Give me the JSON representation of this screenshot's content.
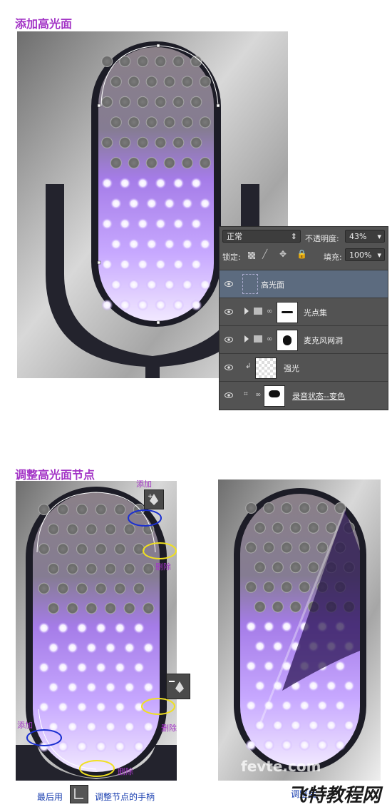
{
  "section1": {
    "title": "添加高光面",
    "panel": {
      "blend_mode": "正常",
      "opacity_label": "不透明度:",
      "opacity_value": "43%",
      "lock_label": "锁定:",
      "fill_label": "填充:",
      "fill_value": "100%",
      "layers": [
        {
          "name": "高光面",
          "active": true
        },
        {
          "name": "光点集",
          "active": false
        },
        {
          "name": "麦克风网洞",
          "active": false
        },
        {
          "name": "强光",
          "active": false
        },
        {
          "name": "录音状态--变色",
          "active": false
        }
      ]
    }
  },
  "section2": {
    "title": "调整高光面节点",
    "annotations": {
      "add_top": "添加",
      "delete_mid": "删除",
      "delete_low": "删除",
      "add_bottom": "添加",
      "delete_bottom": "删除"
    },
    "caption_prefix": "最后用",
    "caption_suffix": "调整节点的手柄",
    "result_label": "调整后",
    "watermark_latin": "fevte.com",
    "watermark_cn": "飞特教程网"
  },
  "colors": {
    "heading": "#a335c6",
    "layer_selected": "#5c6b7f",
    "panel_bg": "#535353",
    "purple_glow": "#a27af0",
    "annotation_blue": "#1a2fd0",
    "annotation_yellow": "#f0e020"
  },
  "icons": [
    "eye-icon",
    "folder-icon",
    "chain-icon",
    "pen-add-icon",
    "pen-delete-icon",
    "convert-point-icon",
    "lock-icon",
    "brush-icon",
    "move-icon",
    "checker-icon",
    "expand-arrow-icon",
    "dropdown-arrow-icon"
  ]
}
